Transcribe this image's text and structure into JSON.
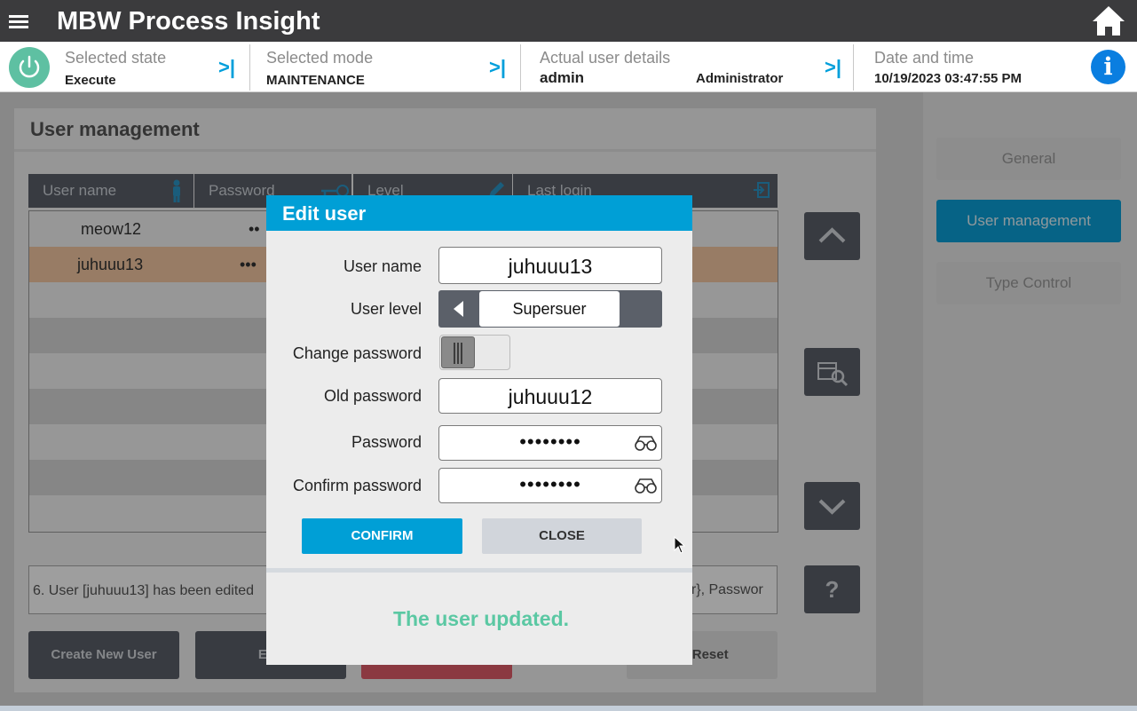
{
  "app": {
    "title": "MBW Process Insight"
  },
  "status": {
    "state_label": "Selected state",
    "state_value": "Execute",
    "mode_label": "Selected mode",
    "mode_value": "MAINTENANCE",
    "user_label": "Actual user details",
    "user_name": "admin",
    "user_role": "Administrator",
    "datetime_label": "Date and time",
    "datetime_value": "10/19/2023 03:47:55 PM",
    "info_glyph": "i"
  },
  "user_management": {
    "title": "User management",
    "columns": [
      "User name",
      "Password",
      "Level",
      "Last login"
    ],
    "rows": [
      {
        "user": "meow12",
        "password": "••"
      },
      {
        "user": "juhuuu13",
        "password": "•••"
      }
    ],
    "log_text": "6. User [juhuuu13] has been edited",
    "log_text_right": "er}, Passwor",
    "buttons": {
      "create": "Create New User",
      "edit": "Edit",
      "reset": "ry Reset"
    }
  },
  "side_nav": {
    "general": "General",
    "user_management": "User management",
    "type_control": "Type Control",
    "help_glyph": "?"
  },
  "dialog": {
    "title": "Edit user",
    "user_name_label": "User name",
    "user_name_value": "juhuuu13",
    "user_level_label": "User level",
    "user_level_value": "Supersuer",
    "change_password_label": "Change password",
    "old_password_label": "Old password",
    "old_password_value": "juhuuu12",
    "password_label": "Password",
    "password_mask": "••••••••",
    "confirm_password_label": "Confirm password",
    "confirm_password_mask": "••••••••",
    "confirm_button": "CONFIRM",
    "close_button": "CLOSE",
    "message": "The user updated."
  },
  "colors": {
    "header_bg": "#3b3b3d",
    "accent": "#009fd6",
    "success": "#5bc8a3",
    "power": "#5ec0a2",
    "info": "#0a7ee0"
  },
  "icons": [
    "menu-icon",
    "home-icon",
    "power-icon",
    "chevron-last-icon",
    "info-icon",
    "person-icon",
    "key-icon",
    "pencil-icon",
    "login-icon",
    "arrow-up-icon",
    "table-search-icon",
    "arrow-down-icon",
    "help-icon",
    "triangle-left-icon",
    "eye-glasses-icon"
  ]
}
